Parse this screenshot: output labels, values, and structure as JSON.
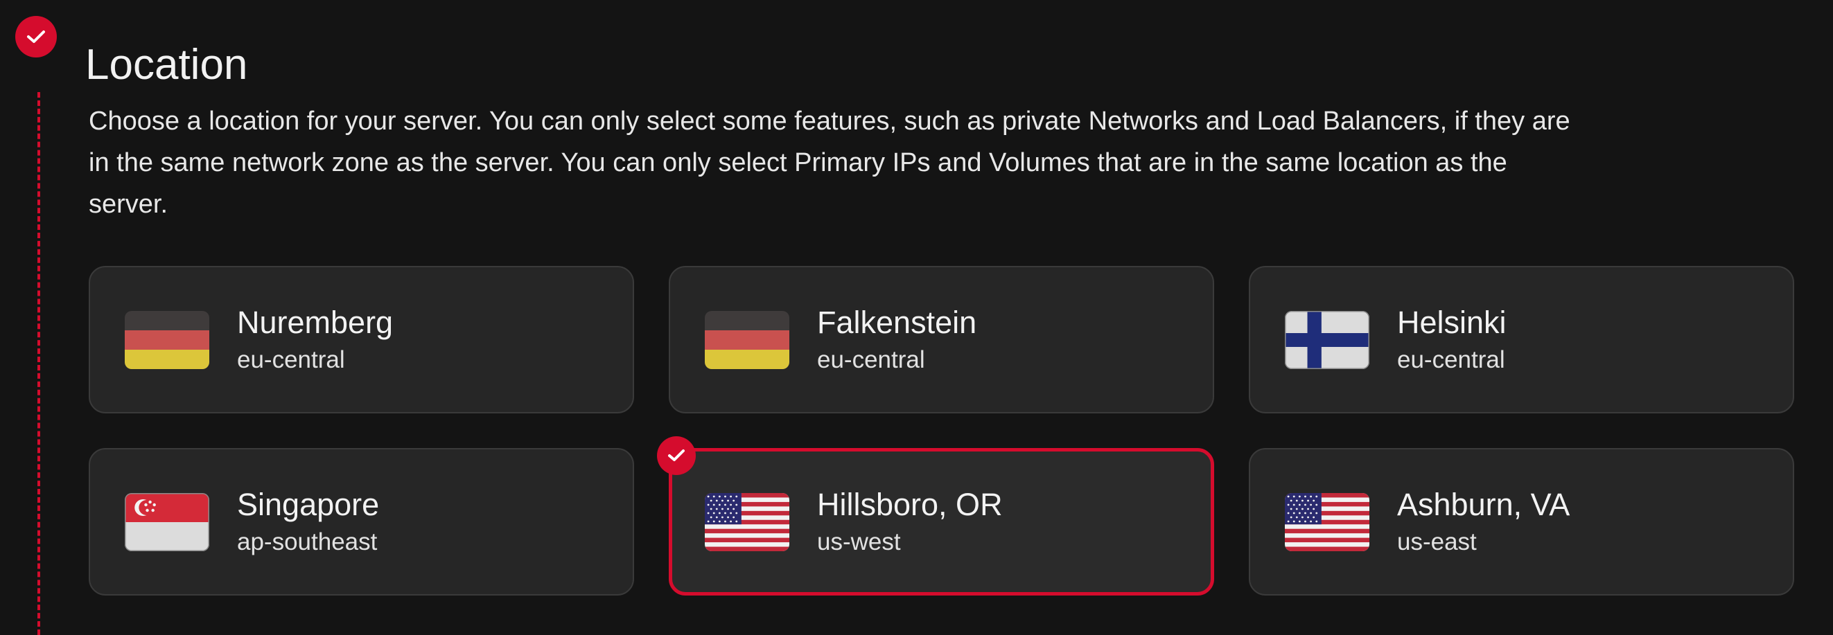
{
  "section": {
    "title": "Location",
    "description": "Choose a location for your server. You can only select some features, such as private Networks and Load Balancers, if they are in the same network zone as the server. You can only select Primary IPs and Volumes that are in the same location as the server."
  },
  "colors": {
    "accent": "#d50c2d",
    "card_bg": "#262626",
    "page_bg": "#141414"
  },
  "locations": [
    {
      "city": "Nuremberg",
      "zone": "eu-central",
      "flag": "germany-flag-icon",
      "selected": false
    },
    {
      "city": "Falkenstein",
      "zone": "eu-central",
      "flag": "germany-flag-icon",
      "selected": false
    },
    {
      "city": "Helsinki",
      "zone": "eu-central",
      "flag": "finland-flag-icon",
      "selected": false
    },
    {
      "city": "Singapore",
      "zone": "ap-southeast",
      "flag": "singapore-flag-icon",
      "selected": false
    },
    {
      "city": "Hillsboro, OR",
      "zone": "us-west",
      "flag": "usa-flag-icon",
      "selected": true
    },
    {
      "city": "Ashburn, VA",
      "zone": "us-east",
      "flag": "usa-flag-icon",
      "selected": false
    }
  ]
}
